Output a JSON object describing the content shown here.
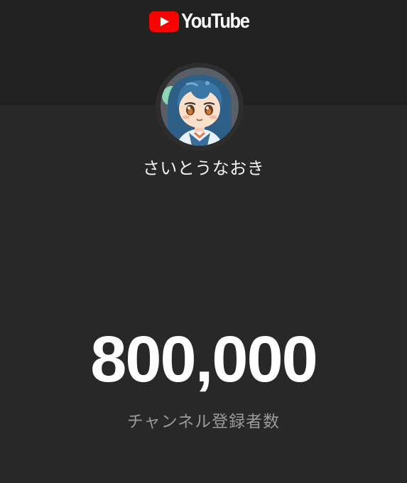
{
  "header": {
    "logo_icon": "youtube-play-icon",
    "logo_text": "YouTube",
    "brand_color": "#ff0000"
  },
  "channel": {
    "avatar_icon": "channel-avatar",
    "name": "さいとうなおき",
    "subscriber_count": "800,000",
    "subscriber_label": "チャンネル登録者数"
  },
  "colors": {
    "background": "#282828",
    "header_band": "#212121",
    "text_primary": "#ffffff",
    "text_secondary": "#9a9a9a"
  }
}
